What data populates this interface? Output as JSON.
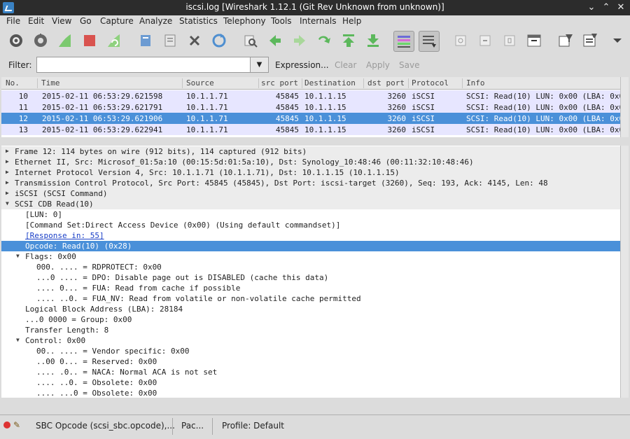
{
  "window": {
    "title": "iscsi.log  [Wireshark 1.12.1  (Git Rev Unknown from unknown)]",
    "minimize_glyph": "⌄",
    "maximize_glyph": "⌃",
    "close_glyph": "✕"
  },
  "menu": [
    "File",
    "Edit",
    "View",
    "Go",
    "Capture",
    "Analyze",
    "Statistics",
    "Telephony",
    "Tools",
    "Internals",
    "Help"
  ],
  "toolbar": {
    "icons": [
      "interface-list-icon",
      "capture-options-icon",
      "start-capture-icon",
      "stop-capture-icon",
      "restart-capture-icon",
      "open-file-icon",
      "save-file-icon",
      "close-file-icon",
      "reload-icon",
      "find-packet-icon",
      "go-back-icon",
      "go-forward-icon",
      "go-to-packet-icon",
      "go-first-icon",
      "go-last-icon",
      "colorize-icon",
      "auto-scroll-icon",
      "zoom-in-icon",
      "zoom-out-icon",
      "normal-size-icon",
      "resize-columns-icon",
      "capture-filters-icon",
      "display-filters-icon",
      "more-icon"
    ]
  },
  "filter": {
    "label": "Filter:",
    "value": "",
    "dropdown_glyph": "▼",
    "expression": "Expression...",
    "clear": "Clear",
    "apply": "Apply",
    "save": "Save"
  },
  "packet_list": {
    "columns": [
      "No.",
      "Time",
      "Source",
      "src port",
      "Destination",
      "dst port",
      "Protocol",
      "Info"
    ],
    "rows": [
      {
        "no": "10",
        "time": "2015-02-11 06:53:29.621598",
        "src": "10.1.1.71",
        "sport": "45845",
        "dst": "10.1.1.15",
        "dport": "3260",
        "proto": "iSCSI",
        "info": "SCSI: Read(10) LUN: 0x00 (LBA: 0x0",
        "selected": false
      },
      {
        "no": "11",
        "time": "2015-02-11 06:53:29.621791",
        "src": "10.1.1.71",
        "sport": "45845",
        "dst": "10.1.1.15",
        "dport": "3260",
        "proto": "iSCSI",
        "info": "SCSI: Read(10) LUN: 0x00 (LBA: 0x0",
        "selected": false
      },
      {
        "no": "12",
        "time": "2015-02-11 06:53:29.621906",
        "src": "10.1.1.71",
        "sport": "45845",
        "dst": "10.1.1.15",
        "dport": "3260",
        "proto": "iSCSI",
        "info": "SCSI: Read(10) LUN: 0x00 (LBA: 0x0",
        "selected": true
      },
      {
        "no": "13",
        "time": "2015-02-11 06:53:29.622941",
        "src": "10.1.1.71",
        "sport": "45845",
        "dst": "10.1.1.15",
        "dport": "3260",
        "proto": "iSCSI",
        "info": "SCSI: Read(10) LUN: 0x00 (LBA: 0x0",
        "selected": false
      }
    ]
  },
  "details": [
    {
      "text": "Frame 12: 114 bytes on wire (912 bits), 114 captured (912 bits)",
      "indent": 0,
      "tri": "right",
      "style": "sec"
    },
    {
      "text": "Ethernet II, Src: Microsof_01:5a:10 (00:15:5d:01:5a:10), Dst: Synology_10:48:46 (00:11:32:10:48:46)",
      "indent": 0,
      "tri": "right",
      "style": "sec"
    },
    {
      "text": "Internet Protocol Version 4, Src: 10.1.1.71 (10.1.1.71), Dst: 10.1.1.15 (10.1.1.15)",
      "indent": 0,
      "tri": "right",
      "style": "sec"
    },
    {
      "text": "Transmission Control Protocol, Src Port: 45845 (45845), Dst Port: iscsi-target (3260), Seq: 193, Ack: 4145, Len: 48",
      "indent": 0,
      "tri": "right",
      "style": "sec"
    },
    {
      "text": "iSCSI (SCSI Command)",
      "indent": 0,
      "tri": "right",
      "style": "sec"
    },
    {
      "text": "SCSI CDB Read(10)",
      "indent": 0,
      "tri": "down",
      "style": "sec"
    },
    {
      "text": "[LUN: 0]",
      "indent": 1,
      "tri": "",
      "style": ""
    },
    {
      "text": "[Command Set:Direct Access Device (0x00) (Using default commandset)]",
      "indent": 1,
      "tri": "",
      "style": ""
    },
    {
      "text": "[Response in: 55]",
      "indent": 1,
      "tri": "",
      "style": "link"
    },
    {
      "text": "Opcode: Read(10) (0x28)",
      "indent": 1,
      "tri": "",
      "style": "sel"
    },
    {
      "text": "Flags: 0x00",
      "indent": 1,
      "tri": "down",
      "style": ""
    },
    {
      "text": "000. .... = RDPROTECT: 0x00",
      "indent": 2,
      "tri": "",
      "style": ""
    },
    {
      "text": "...0 .... = DPO: Disable page out is DISABLED (cache this data)",
      "indent": 2,
      "tri": "",
      "style": ""
    },
    {
      "text": ".... 0... = FUA: Read from cache if possible",
      "indent": 2,
      "tri": "",
      "style": ""
    },
    {
      "text": ".... ..0. = FUA_NV: Read from volatile or non-volatile cache permitted",
      "indent": 2,
      "tri": "",
      "style": ""
    },
    {
      "text": "Logical Block Address (LBA): 28184",
      "indent": 1,
      "tri": "",
      "style": ""
    },
    {
      "text": "...0 0000 = Group: 0x00",
      "indent": 1,
      "tri": "",
      "style": ""
    },
    {
      "text": "Transfer Length: 8",
      "indent": 1,
      "tri": "",
      "style": ""
    },
    {
      "text": "Control: 0x00",
      "indent": 1,
      "tri": "down",
      "style": ""
    },
    {
      "text": "00.. .... = Vendor specific: 0x00",
      "indent": 2,
      "tri": "",
      "style": ""
    },
    {
      "text": "..00 0... = Reserved: 0x00",
      "indent": 2,
      "tri": "",
      "style": ""
    },
    {
      "text": ".... .0.. = NACA: Normal ACA is not set",
      "indent": 2,
      "tri": "",
      "style": ""
    },
    {
      "text": ".... ..0. = Obsolete: 0x00",
      "indent": 2,
      "tri": "",
      "style": ""
    },
    {
      "text": ".... ...0 = Obsolete: 0x00",
      "indent": 2,
      "tri": "",
      "style": ""
    }
  ],
  "status": {
    "field": "SBC Opcode (scsi_sbc.opcode),...",
    "packets": "Pac...",
    "profile": "Profile: Default"
  },
  "colors": {
    "row_bg": "#e7e6ff",
    "selected": "#4a90d9",
    "link": "#1a3fc7"
  }
}
